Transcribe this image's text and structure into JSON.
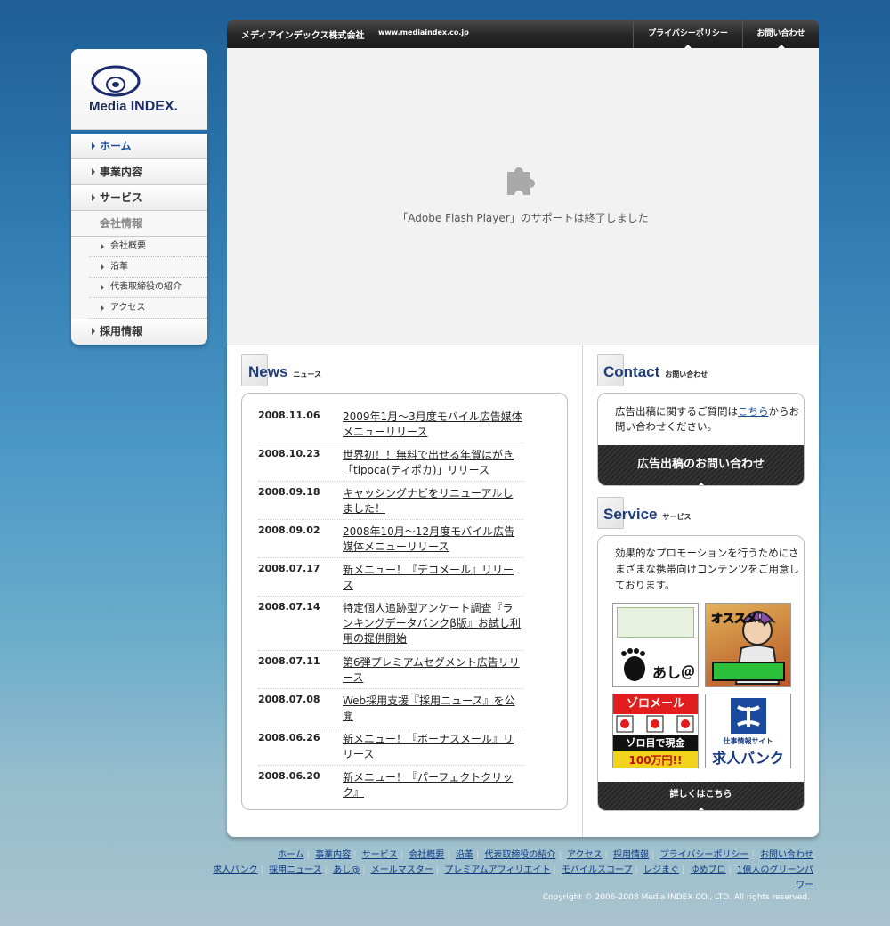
{
  "logo": {
    "text_a": "Media",
    "text_b": "INDEX."
  },
  "sidebar": {
    "items": [
      {
        "label": "ホーム"
      },
      {
        "label": "事業内容"
      },
      {
        "label": "サービス"
      },
      {
        "label": "会社情報"
      },
      {
        "label": "会社概要"
      },
      {
        "label": "沿革"
      },
      {
        "label": "代表取締役の紹介"
      },
      {
        "label": "アクセス"
      },
      {
        "label": "採用情報"
      }
    ]
  },
  "header": {
    "company": "メディアインデックス株式会社",
    "url": "www.mediaindex.co.jp",
    "links": [
      "プライバシーポリシー",
      "お問い合わせ"
    ]
  },
  "flash": {
    "message": "「Adobe Flash Player」のサポートは終了しました"
  },
  "news": {
    "title": "News",
    "title_jp": "ニュース",
    "items": [
      {
        "date": "2008.11.06",
        "text": "2009年1月～3月度モバイル広告媒体メニューリリース"
      },
      {
        "date": "2008.10.23",
        "text": "世界初！！無料で出せる年賀はがき「tipoca(ティポカ)」リリース"
      },
      {
        "date": "2008.09.18",
        "text": "キャッシングナビをリニューアルしました！"
      },
      {
        "date": "2008.09.02",
        "text": "2008年10月～12月度モバイル広告媒体メニューリリース"
      },
      {
        "date": "2008.07.17",
        "text": "新メニュー！『デコメール』リリース"
      },
      {
        "date": "2008.07.14",
        "text": "特定個人追跡型アンケート調査『ランキングデータバンクβ版』お試し利用の提供開始"
      },
      {
        "date": "2008.07.11",
        "text": "第6弾プレミアムセグメント広告リリース"
      },
      {
        "date": "2008.07.08",
        "text": "Web採用支援『採用ニュース』を公開"
      },
      {
        "date": "2008.06.26",
        "text": "新メニュー！『ボーナスメール』リリース"
      },
      {
        "date": "2008.06.20",
        "text": "新メニュー！『パーフェクトクリック』"
      }
    ]
  },
  "contact": {
    "title": "Contact",
    "title_jp": "お問い合わせ",
    "text_before": "広告出稿に関するご質問は",
    "link": "こちら",
    "text_after": "からお問い合わせください。",
    "button": "広告出稿のお問い合わせ"
  },
  "service": {
    "title": "Service",
    "title_jp": "サービス",
    "text": "効果的なプロモーションを行うためにさまざまな携帯向けコンテンツをご用意しております。",
    "tiles": [
      {
        "label": "あし＠"
      },
      {
        "label": "オススメ!"
      },
      {
        "label": "ゾロメール",
        "line2": "ゾロ目で現金",
        "line3": "100万円!!"
      },
      {
        "label": "仕事情報サイト",
        "line2": "求人バンク"
      }
    ],
    "button": "詳しくはこちら"
  },
  "footer": {
    "row1": [
      "ホーム",
      "事業内容",
      "サービス",
      "会社概要",
      "沿革",
      "代表取締役の紹介",
      "アクセス",
      "採用情報",
      "プライバシーポリシー",
      "お問い合わせ"
    ],
    "row2": [
      "求人バンク",
      "採用ニュース",
      "あし@",
      "メールマスター",
      "プレミアムアフィリエイト",
      "モバイルスコープ",
      "レジまぐ",
      "ゆめブロ",
      "1億人のグリーンパ"
    ],
    "row3": [
      "ワー"
    ],
    "copyright": "Copyright © 2006-2008 Media INDEX CO., LTD. All rights reserved."
  },
  "colors": {
    "link": "#0e3b87",
    "accent": "#1f3d7a",
    "active_nav": "#1b4f9a"
  },
  "icons": [
    "puzzle-piece-icon",
    "news-doc-icon",
    "contact-doc-icon",
    "service-doc-icon"
  ]
}
